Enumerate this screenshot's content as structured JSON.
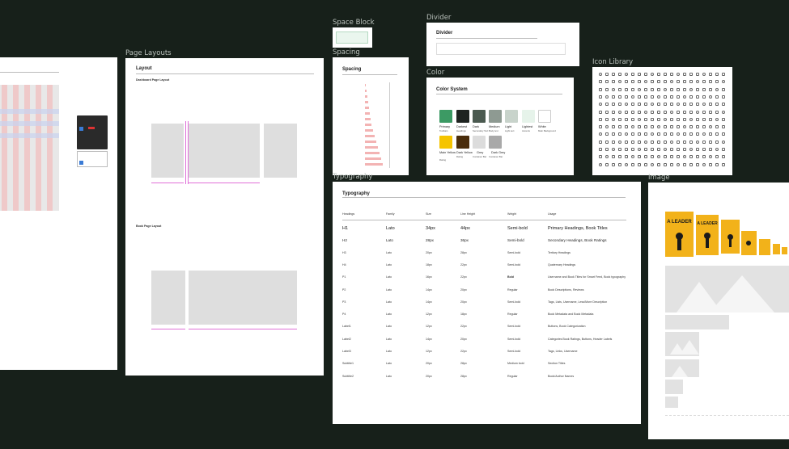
{
  "frames": {
    "space_block": {
      "label": "Space Block"
    },
    "divider": {
      "label": "Divider",
      "title": "Divider"
    },
    "page_layouts": {
      "label": "Page Layouts",
      "title": "Layout",
      "sub1": "Dashboard Page Layout",
      "sub2": "Book Page Layout"
    },
    "spacing": {
      "label": "Spacing",
      "title": "Spacing"
    },
    "color": {
      "label": "Color",
      "title": "Color System",
      "row1": [
        {
          "name": "Primary",
          "desc": "Toolbars",
          "hex": "#3c9a64"
        },
        {
          "name": "Darkest",
          "desc": "Headings",
          "hex": "#1f2421"
        },
        {
          "name": "Dark",
          "desc": "Secondary Text",
          "hex": "#4b5a50"
        },
        {
          "name": "Medium",
          "desc": "Body text",
          "hex": "#8e9a92"
        },
        {
          "name": "Light",
          "desc": "Light text",
          "hex": "#c8d3cb"
        },
        {
          "name": "Lightest",
          "desc": "Accents",
          "hex": "#e6f3ea"
        },
        {
          "name": "White",
          "desc": "Main Background",
          "hex": "#ffffff"
        }
      ],
      "row2": [
        {
          "name": "Main Yellow",
          "desc": "Rating",
          "hex": "#f5c400"
        },
        {
          "name": "Dark Yellow",
          "desc": "Rating",
          "hex": "#4a2d0c"
        },
        {
          "name": "Grey",
          "desc": "Container Bar",
          "hex": "#dcdcdc"
        },
        {
          "name": "Dark Grey",
          "desc": "Container Bar",
          "hex": "#a9a9a9"
        }
      ]
    },
    "icon_library": {
      "label": "Icon Library"
    },
    "typography": {
      "label": "Typography",
      "title": "Typography",
      "headers": [
        "Headings",
        "Family",
        "Size",
        "Line Height",
        "Weight",
        "Usage"
      ],
      "rows": [
        [
          "H1",
          "Lato",
          "34px",
          "44px",
          "Semi-bold",
          "Primary Headings, Book Titles"
        ],
        [
          "H2",
          "Lato",
          "28px",
          "36px",
          "Semi-bold",
          "Secondary Headings, Book Ratings"
        ],
        [
          "H3",
          "Lato",
          "20px",
          "28px",
          "Semi-bold",
          "Tertiary Headings"
        ],
        [
          "H4",
          "Lato",
          "18px",
          "22px",
          "Semi-bold",
          "Quaternary Headings"
        ],
        [
          "P1",
          "Lato",
          "16px",
          "22px",
          "Bold",
          "Username and Book Titles for Smart Feed, Book typography"
        ],
        [
          "P2",
          "Lato",
          "14px",
          "20px",
          "Regular",
          "Book Descriptions, Reviews"
        ],
        [
          "P3",
          "Lato",
          "14px",
          "20px",
          "Semi-bold",
          "Tags, Lists, Username, Less/More Description"
        ],
        [
          "P4",
          "Lato",
          "12px",
          "18px",
          "Regular",
          "Book Metadata and Book Metadata"
        ],
        [
          "Label1",
          "Lato",
          "12px",
          "22px",
          "Semi-bold",
          "Buttons, Book Categorization"
        ],
        [
          "Label2",
          "Lato",
          "14px",
          "20px",
          "Semi-bold",
          "Categories Book Ratings, Buttons, Header Labels"
        ],
        [
          "Label3",
          "Lato",
          "12px",
          "22px",
          "Semi-bold",
          "Tags, Links, Username"
        ],
        [
          "Subtitle1",
          "Lato",
          "20px",
          "28px",
          "Medium bold",
          "Section Titles"
        ],
        [
          "Subtitle2",
          "Lato",
          "20px",
          "28px",
          "Regular",
          "Book/Author Names"
        ]
      ]
    },
    "image": {
      "label": "Image",
      "book_text": "A LEADER"
    }
  }
}
